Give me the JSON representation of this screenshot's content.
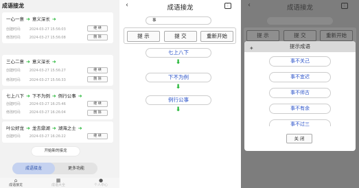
{
  "screen1": {
    "title": "成语接龙",
    "created_label": "创建时间:",
    "modified_label": "修改时间:",
    "continue_label": "继 续",
    "delete_label": "删 除",
    "cards": [
      {
        "words": [
          "一心一意",
          "意义深长"
        ],
        "created": "2024-03-27 15:56:03",
        "modified": "2024-03-27 15:56:08"
      },
      {
        "words": [
          "三心二意",
          "意义深长"
        ],
        "created": "2024-03-27 15:56:27",
        "modified": "2024-03-27 15:56:33"
      },
      {
        "words": [
          "七上八下",
          "下不为例",
          "例行公事"
        ],
        "created": "2024-03-27 16:25:46",
        "modified": "2024-03-27 16:26:04"
      },
      {
        "words": [
          "叶公好龙",
          "龙去鼎湖",
          "湖海之士"
        ],
        "created": "2024-03-27 16:26:22",
        "modified": "2024-03-27 16:26:33"
      }
    ],
    "new_button": "开始新的接龙",
    "segments": [
      "成语接龙",
      "更多功能"
    ],
    "nav": [
      {
        "icon": "home-icon",
        "label": "成语接龙"
      },
      {
        "icon": "grid-icon",
        "label": "成语大全"
      },
      {
        "icon": "user-icon",
        "label": "个人中心"
      }
    ]
  },
  "screen2": {
    "title": "成语接龙",
    "input_value": "事",
    "buttons": [
      "提 示",
      "提 交",
      "重新开始"
    ],
    "chain": [
      "七上八下",
      "下不为例",
      "例行公事"
    ]
  },
  "screen3": {
    "title": "成语接龙",
    "buttons": [
      "提 示",
      "提 交",
      "重新开始"
    ],
    "dialog_title": "提示成语",
    "suggestions": [
      "事不关己",
      "事不宜迟",
      "事不师古",
      "事不有余",
      "事不过三"
    ],
    "close_label": "关 闭"
  },
  "colors": {
    "accent_green": "#28b83a",
    "link_blue": "#2a52c9",
    "segment_active": "#c5d2f0",
    "overlay_gray": "#7d7d7d"
  }
}
